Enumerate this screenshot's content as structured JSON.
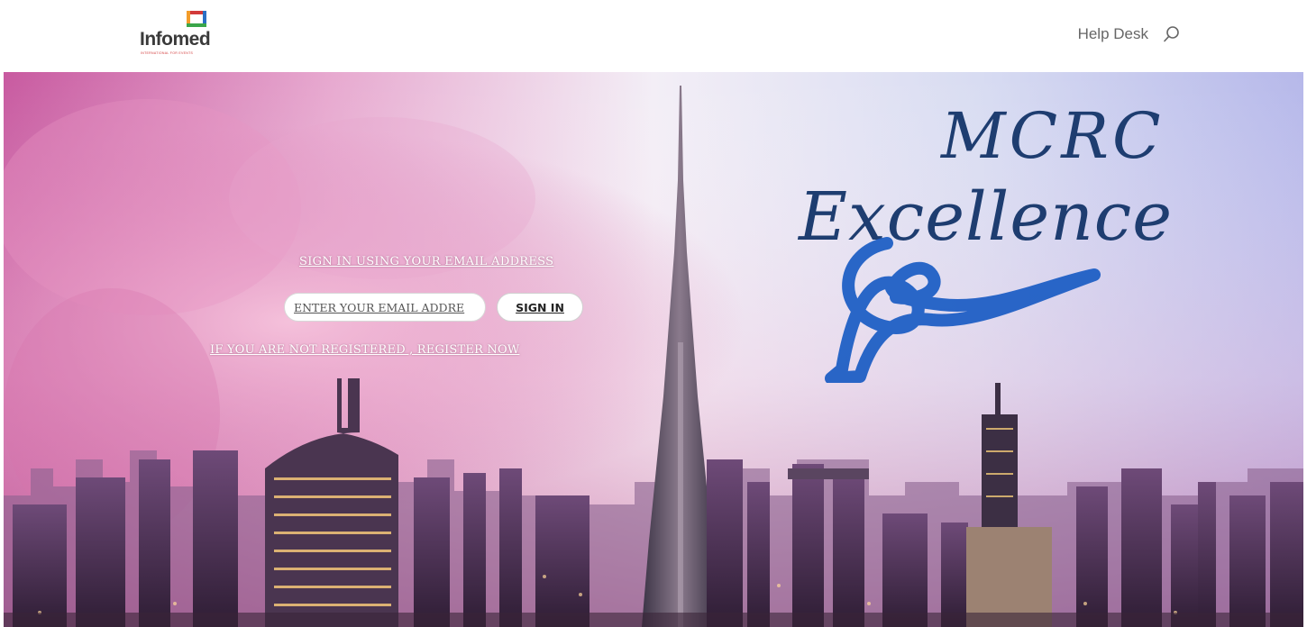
{
  "header": {
    "logo_text": "Infomed",
    "logo_tagline": "INTERNATIONAL FOR EVENTS",
    "nav_help_desk": "Help Desk",
    "search_icon": "search-icon"
  },
  "hero": {
    "signin_heading": "SIGN IN USING YOUR EMAIL ADDRESS",
    "email_placeholder": "ENTER YOUR EMAIL ADDRE",
    "signin_button": "SIGN IN",
    "register_link": "IF YOU ARE NOT REGISTERED , REGISTER NOW",
    "brand_line_1": "MCRC",
    "brand_line_2": "Excellence",
    "ribbon_icon": "awareness-ribbon-icon"
  },
  "colors": {
    "brand_blue": "#1e3d70",
    "ribbon_blue": "#1f5fc4",
    "nav_text": "#666666",
    "logo_red": "#d23a3a",
    "logo_orange": "#f39c2a",
    "logo_blue": "#2a6fc4",
    "logo_green": "#3aa64a"
  }
}
